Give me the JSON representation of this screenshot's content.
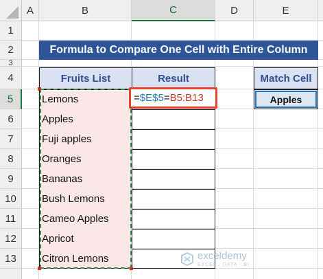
{
  "sheet": {
    "columns": [
      "A",
      "B",
      "C",
      "D",
      "E"
    ],
    "rows": [
      "1",
      "2",
      "3",
      "4",
      "5",
      "6",
      "7",
      "8",
      "9",
      "10",
      "11",
      "12",
      "13"
    ],
    "selected_column": "C",
    "selected_row": "5"
  },
  "title": "Formula to Compare One Cell with Entire Column",
  "table": {
    "headers": {
      "fruits": "Fruits List",
      "result": "Result"
    },
    "fruits": [
      "Lemons",
      "Apples",
      "Fuji apples",
      "Oranges",
      "Bananas",
      "Bush Lemons",
      "Cameo Apples",
      "Apricot",
      "Citron Lemons"
    ],
    "formula": {
      "prefix": "=",
      "ref_abs": "$E$5",
      "op": "=",
      "ref_range": "B5:B13"
    }
  },
  "match": {
    "header": "Match Cell",
    "value": "Apples"
  },
  "watermark": {
    "brand": "exceldemy",
    "tagline": "EXCEL · DATA · BI"
  },
  "colors": {
    "title_bg": "#2e5597",
    "header_bg": "#d9e1f2",
    "fruit_bg": "#fbe7e7",
    "highlight": "#e8432d",
    "ref_blue": "#2f75b5",
    "ref_red": "#c0392b",
    "select_green": "#217346"
  }
}
